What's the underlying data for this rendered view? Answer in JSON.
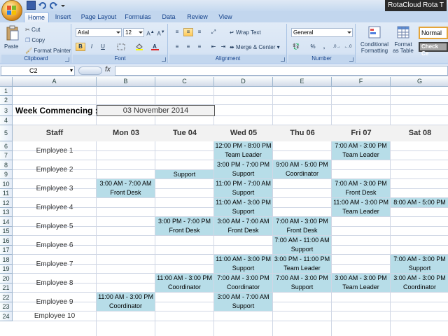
{
  "window": {
    "title": "RotaCloud Rota T"
  },
  "ribbon": {
    "tabs": [
      "Home",
      "Insert",
      "Page Layout",
      "Formulas",
      "Data",
      "Review",
      "View"
    ],
    "clipboard": {
      "paste": "Paste",
      "cut": "Cut",
      "copy": "Copy",
      "format_painter": "Format Painter",
      "label": "Clipboard"
    },
    "font": {
      "name": "Arial",
      "size": "12",
      "bold": "B",
      "italic": "I",
      "underline": "U",
      "label": "Font"
    },
    "alignment": {
      "wrap": "Wrap Text",
      "merge": "Merge & Center",
      "label": "Alignment"
    },
    "number": {
      "format": "General",
      "percent": "%",
      "comma": ",",
      "label": "Number"
    },
    "styles": {
      "conditional": "Conditional",
      "conditional2": "Formatting",
      "format_as": "Format",
      "format_as2": "as Table",
      "normal": "Normal",
      "check": "Check Ce"
    }
  },
  "formula_bar": {
    "name_box": "C2",
    "fx": "fx",
    "value": ""
  },
  "sheet": {
    "columns": [
      "A",
      "B",
      "C",
      "D",
      "E",
      "F",
      "G"
    ],
    "rows": [
      "1",
      "2",
      "3",
      "4",
      "5",
      "6",
      "7",
      "8",
      "9",
      "10",
      "11",
      "12",
      "13",
      "14",
      "15",
      "16",
      "17",
      "18",
      "19",
      "20",
      "21",
      "22",
      "23",
      "24"
    ],
    "week_label": "Week Commencing :",
    "week_date": "03 November 2014",
    "headers": [
      "Staff",
      "Mon 03",
      "Tue 04",
      "Wed 05",
      "Thu 06",
      "Fri 07",
      "Sat 08"
    ],
    "employees": [
      "Employee 1",
      "Employee 2",
      "Employee 3",
      "Employee 4",
      "Employee 5",
      "Employee 6",
      "Employee 7",
      "Employee 8",
      "Employee 9",
      "Employee 10"
    ],
    "shifts": [
      {
        "emp": 0,
        "day": 3,
        "time": "12:00 PM - 8:00 PM",
        "role": "Team Leader"
      },
      {
        "emp": 0,
        "day": 5,
        "time": "7:00 AM - 3:00 PM",
        "role": "Team Leader"
      },
      {
        "emp": 1,
        "day": 2,
        "time": "",
        "role": "Support",
        "half": true
      },
      {
        "emp": 1,
        "day": 3,
        "time": "3:00 PM - 7:00 PM",
        "role": "Support"
      },
      {
        "emp": 1,
        "day": 4,
        "time": "9:00 AM - 5:00 PM",
        "role": "Coordinator"
      },
      {
        "emp": 2,
        "day": 1,
        "time": "3:00 AM - 7:00 AM",
        "role": "Front Desk"
      },
      {
        "emp": 2,
        "day": 3,
        "time": "11:00 PM - 7:00 AM",
        "role": "Support"
      },
      {
        "emp": 2,
        "day": 5,
        "time": "7:00 AM - 3:00 PM",
        "role": "Front Desk"
      },
      {
        "emp": 3,
        "day": 3,
        "time": "11:00 AM - 3:00 PM",
        "role": "Support"
      },
      {
        "emp": 3,
        "day": 5,
        "time": "11:00 AM - 3:00 PM",
        "role": "Team Leader"
      },
      {
        "emp": 3,
        "day": 6,
        "time": "8:00 AM - 5:00 PM",
        "role": "",
        "half": true
      },
      {
        "emp": 4,
        "day": 2,
        "time": "3:00 PM - 7:00 PM",
        "role": "Front Desk"
      },
      {
        "emp": 4,
        "day": 3,
        "time": "3:00 AM - 7:00 AM",
        "role": "Front Desk"
      },
      {
        "emp": 4,
        "day": 4,
        "time": "7:00 AM - 3:00 PM",
        "role": "Front Desk"
      },
      {
        "emp": 5,
        "day": 4,
        "time": "7:00 AM - 11:00 AM",
        "role": "Support"
      },
      {
        "emp": 6,
        "day": 3,
        "time": "11:00 AM - 3:00 PM",
        "role": "Support"
      },
      {
        "emp": 6,
        "day": 4,
        "time": "3:00 PM - 11:00 PM",
        "role": "Team Leader"
      },
      {
        "emp": 6,
        "day": 6,
        "time": "7:00 AM - 3:00 PM",
        "role": "Support"
      },
      {
        "emp": 7,
        "day": 2,
        "time": "11:00 AM - 3:00 PM",
        "role": "Coordinator"
      },
      {
        "emp": 7,
        "day": 3,
        "time": "7:00 AM - 3:00 PM",
        "role": "Coordinator"
      },
      {
        "emp": 7,
        "day": 4,
        "time": "7:00 AM - 3:00 PM",
        "role": "Support"
      },
      {
        "emp": 7,
        "day": 5,
        "time": "3:00 AM - 3:00 PM",
        "role": "Team Leader"
      },
      {
        "emp": 7,
        "day": 6,
        "time": "3:00 AM - 3:00 PM",
        "role": "Coordinator"
      },
      {
        "emp": 8,
        "day": 1,
        "time": "11:00 AM - 3:00 PM",
        "role": "Coordinator"
      },
      {
        "emp": 8,
        "day": 3,
        "time": "3:00 AM - 7:00 AM",
        "role": "Support"
      }
    ],
    "shift_color": "#b7dde8"
  }
}
